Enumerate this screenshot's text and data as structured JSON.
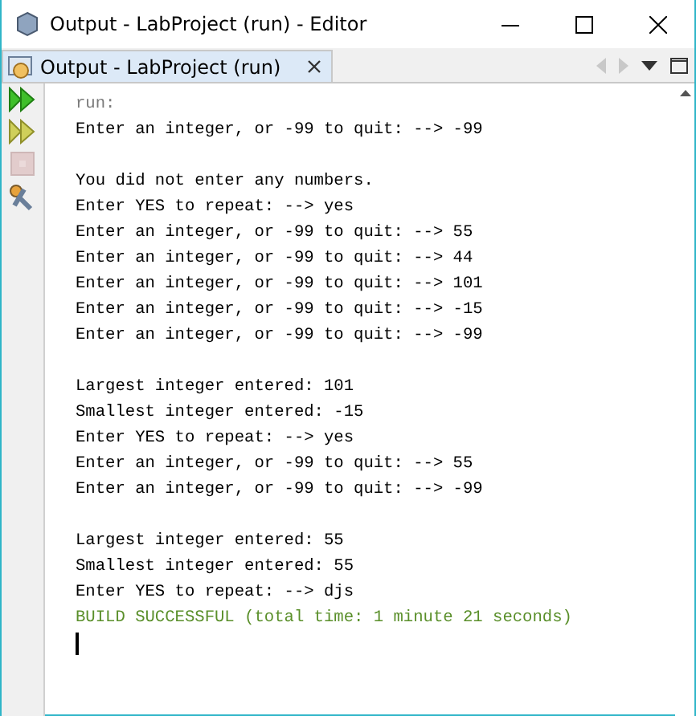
{
  "window": {
    "title": "Output - LabProject (run)  - Editor"
  },
  "tabs": [
    {
      "label": "Output - LabProject (run)",
      "selected": true
    }
  ],
  "toolbar": [
    {
      "kind": "run",
      "disabled": false
    },
    {
      "kind": "rerun",
      "disabled": false
    },
    {
      "kind": "stop",
      "disabled": true
    },
    {
      "kind": "settings",
      "disabled": false
    }
  ],
  "output": [
    {
      "kind": "meta",
      "text": "run:"
    },
    {
      "kind": "out",
      "text": "Enter an integer, or -99 to quit: --> -99"
    },
    {
      "kind": "blank"
    },
    {
      "kind": "out",
      "text": "You did not enter any numbers."
    },
    {
      "kind": "out",
      "text": "Enter YES to repeat: --> yes"
    },
    {
      "kind": "out",
      "text": "Enter an integer, or -99 to quit: --> 55"
    },
    {
      "kind": "out",
      "text": "Enter an integer, or -99 to quit: --> 44"
    },
    {
      "kind": "out",
      "text": "Enter an integer, or -99 to quit: --> 101"
    },
    {
      "kind": "out",
      "text": "Enter an integer, or -99 to quit: --> -15"
    },
    {
      "kind": "out",
      "text": "Enter an integer, or -99 to quit: --> -99"
    },
    {
      "kind": "blank"
    },
    {
      "kind": "out",
      "text": "Largest integer entered: 101"
    },
    {
      "kind": "out",
      "text": "Smallest integer entered: -15"
    },
    {
      "kind": "out",
      "text": "Enter YES to repeat: --> yes"
    },
    {
      "kind": "out",
      "text": "Enter an integer, or -99 to quit: --> 55"
    },
    {
      "kind": "out",
      "text": "Enter an integer, or -99 to quit: --> -99"
    },
    {
      "kind": "blank"
    },
    {
      "kind": "out",
      "text": "Largest integer entered: 55"
    },
    {
      "kind": "out",
      "text": "Smallest integer entered: 55"
    },
    {
      "kind": "out",
      "text": "Enter YES to repeat: --> djs"
    },
    {
      "kind": "success",
      "text": "BUILD SUCCESSFUL (total time: 1 minute 21 seconds)"
    }
  ]
}
